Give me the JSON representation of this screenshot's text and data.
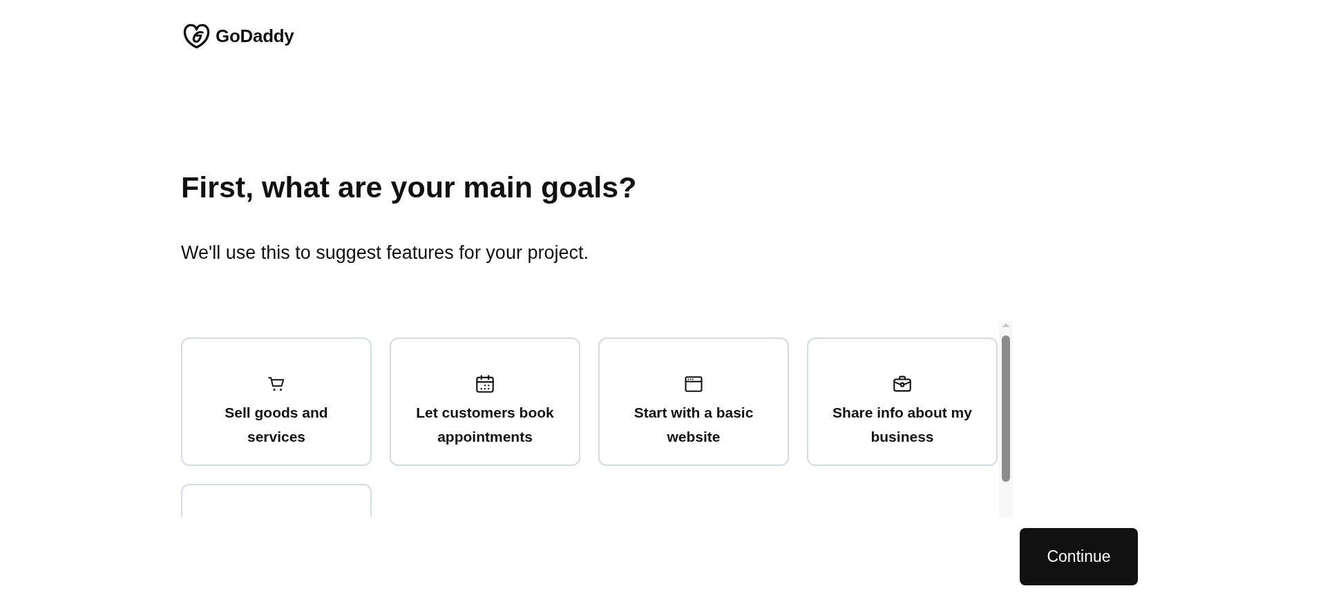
{
  "logo": {
    "text": "GoDaddy"
  },
  "heading": "First, what are your main goals?",
  "subtitle": "We'll use this to suggest features for your project.",
  "goals": [
    {
      "kind": "option",
      "label": "Sell goods and services",
      "selected": false
    },
    {
      "kind": "option",
      "label": "Let customers book appointments",
      "selected": false
    },
    {
      "kind": "option",
      "label": "Start with a basic website",
      "selected": false
    },
    {
      "kind": "option",
      "label": "Share info about my business",
      "selected": false
    },
    {
      "kind": "cut-off",
      "selected": false
    }
  ],
  "continue_button": {
    "label": "Continue"
  }
}
